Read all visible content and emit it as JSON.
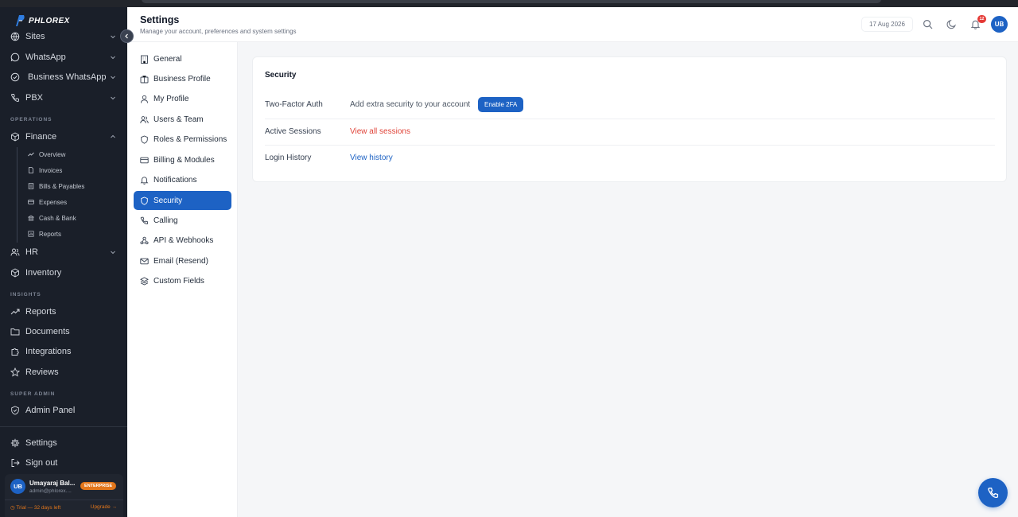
{
  "brand": {
    "name": "PHLOREX"
  },
  "sidebar": {
    "top_items": [
      {
        "label": "Sites",
        "icon": "globe-icon"
      },
      {
        "label": "WhatsApp",
        "icon": "chat-icon"
      },
      {
        "label": "Business WhatsApp",
        "icon": "check-circle-icon"
      },
      {
        "label": "PBX",
        "icon": "phone-icon"
      }
    ],
    "sections": {
      "operations": "OPERATIONS",
      "insights": "INSIGHTS",
      "super_admin": "SUPER ADMIN"
    },
    "finance": {
      "label": "Finance",
      "sub_items": [
        {
          "label": "Overview",
          "icon": "trend-icon"
        },
        {
          "label": "Invoices",
          "icon": "document-icon"
        },
        {
          "label": "Bills & Payables",
          "icon": "bill-icon"
        },
        {
          "label": "Expenses",
          "icon": "card-icon"
        },
        {
          "label": "Cash & Bank",
          "icon": "bank-icon"
        },
        {
          "label": "Reports",
          "icon": "chart-icon"
        }
      ]
    },
    "hr": {
      "label": "HR"
    },
    "inventory": {
      "label": "Inventory"
    },
    "insight_items": [
      {
        "label": "Reports",
        "icon": "trend-icon"
      },
      {
        "label": "Documents",
        "icon": "folder-icon"
      },
      {
        "label": "Integrations",
        "icon": "puzzle-icon"
      },
      {
        "label": "Reviews",
        "icon": "star-icon"
      }
    ],
    "admin_panel": {
      "label": "Admin Panel"
    },
    "settings": {
      "label": "Settings"
    },
    "sign_out": {
      "label": "Sign out"
    },
    "user": {
      "initials": "UB",
      "name": "Umayaraj Bal...",
      "email": "admin@phlorex....",
      "plan_badge": "ENTERPRISE",
      "trial_text": "Trial — 32 days left",
      "upgrade_label": "Upgrade →"
    }
  },
  "header": {
    "title": "Settings",
    "subtitle": "Manage your account, preferences and system settings",
    "date": "17 Aug 2026",
    "notification_count": "12",
    "avatar_initials": "UB"
  },
  "settings_nav": {
    "items": [
      {
        "label": "General",
        "icon": "building-icon"
      },
      {
        "label": "Business Profile",
        "icon": "briefcase-icon"
      },
      {
        "label": "My Profile",
        "icon": "user-icon"
      },
      {
        "label": "Users & Team",
        "icon": "users-icon"
      },
      {
        "label": "Roles & Permissions",
        "icon": "shield-icon"
      },
      {
        "label": "Billing & Modules",
        "icon": "card-icon"
      },
      {
        "label": "Notifications",
        "icon": "bell-icon"
      },
      {
        "label": "Security",
        "icon": "shield-icon"
      },
      {
        "label": "Calling",
        "icon": "phone-icon"
      },
      {
        "label": "API & Webhooks",
        "icon": "webhook-icon"
      },
      {
        "label": "Email (Resend)",
        "icon": "mail-icon"
      },
      {
        "label": "Custom Fields",
        "icon": "layers-icon"
      }
    ],
    "active": "Security"
  },
  "security": {
    "title": "Security",
    "two_factor": {
      "label": "Two-Factor Auth",
      "description": "Add extra security to your account",
      "button": "Enable 2FA"
    },
    "active_sessions": {
      "label": "Active Sessions",
      "link": "View all sessions"
    },
    "login_history": {
      "label": "Login History",
      "link": "View history"
    }
  },
  "colors": {
    "accent": "#1d62c4",
    "sidebar_bg": "#1a1f29",
    "danger_link": "#e0453a",
    "badge_orange": "#e2761b"
  }
}
